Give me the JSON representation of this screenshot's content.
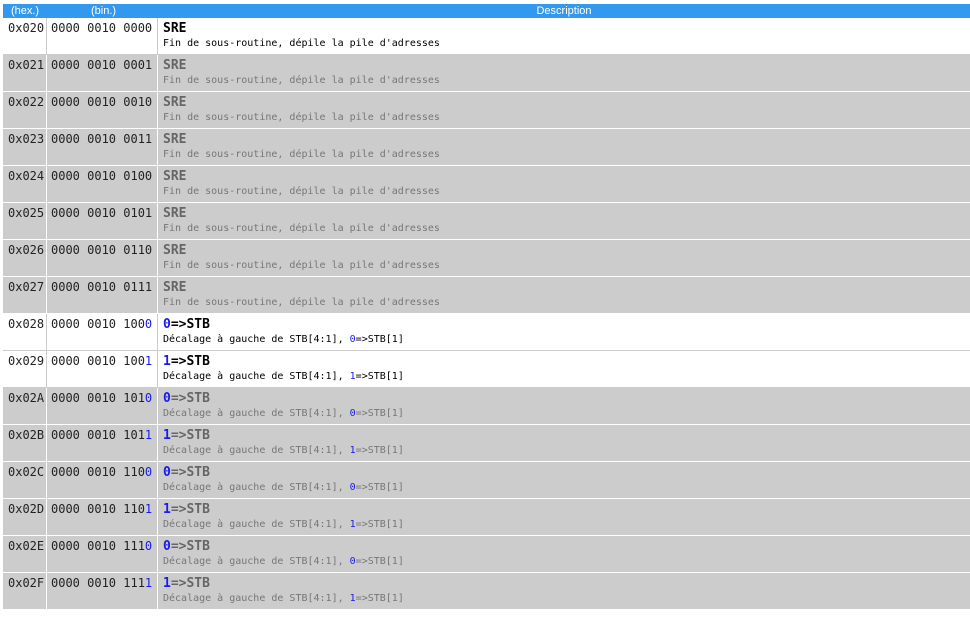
{
  "header": {
    "hex": "(hex.)",
    "bin": "(bin.)",
    "description": "Description"
  },
  "rows": [
    {
      "hex": "0x020",
      "bin_prefix": "0000 0010 0000",
      "bin_hi": "",
      "mn_hi": "",
      "mn_rest": "SRE",
      "desc_pre": "Fin de sous-routine, dépile la pile d'adresses",
      "desc_hi": "",
      "desc_post": "",
      "active": true
    },
    {
      "hex": "0x021",
      "bin_prefix": "0000 0010 0001",
      "bin_hi": "",
      "mn_hi": "",
      "mn_rest": "SRE",
      "desc_pre": "Fin de sous-routine, dépile la pile d'adresses",
      "desc_hi": "",
      "desc_post": "",
      "active": false
    },
    {
      "hex": "0x022",
      "bin_prefix": "0000 0010 0010",
      "bin_hi": "",
      "mn_hi": "",
      "mn_rest": "SRE",
      "desc_pre": "Fin de sous-routine, dépile la pile d'adresses",
      "desc_hi": "",
      "desc_post": "",
      "active": false
    },
    {
      "hex": "0x023",
      "bin_prefix": "0000 0010 0011",
      "bin_hi": "",
      "mn_hi": "",
      "mn_rest": "SRE",
      "desc_pre": "Fin de sous-routine, dépile la pile d'adresses",
      "desc_hi": "",
      "desc_post": "",
      "active": false
    },
    {
      "hex": "0x024",
      "bin_prefix": "0000 0010 0100",
      "bin_hi": "",
      "mn_hi": "",
      "mn_rest": "SRE",
      "desc_pre": "Fin de sous-routine, dépile la pile d'adresses",
      "desc_hi": "",
      "desc_post": "",
      "active": false
    },
    {
      "hex": "0x025",
      "bin_prefix": "0000 0010 0101",
      "bin_hi": "",
      "mn_hi": "",
      "mn_rest": "SRE",
      "desc_pre": "Fin de sous-routine, dépile la pile d'adresses",
      "desc_hi": "",
      "desc_post": "",
      "active": false
    },
    {
      "hex": "0x026",
      "bin_prefix": "0000 0010 0110",
      "bin_hi": "",
      "mn_hi": "",
      "mn_rest": "SRE",
      "desc_pre": "Fin de sous-routine, dépile la pile d'adresses",
      "desc_hi": "",
      "desc_post": "",
      "active": false
    },
    {
      "hex": "0x027",
      "bin_prefix": "0000 0010 0111",
      "bin_hi": "",
      "mn_hi": "",
      "mn_rest": "SRE",
      "desc_pre": "Fin de sous-routine, dépile la pile d'adresses",
      "desc_hi": "",
      "desc_post": "",
      "active": false
    },
    {
      "hex": "0x028",
      "bin_prefix": "0000 0010 100",
      "bin_hi": "0",
      "mn_hi": "0",
      "mn_rest": "=>STB",
      "desc_pre": "Décalage à gauche de STB[4:1], ",
      "desc_hi": "0",
      "desc_post": "=>STB[1]",
      "active": true
    },
    {
      "hex": "0x029",
      "bin_prefix": "0000 0010 100",
      "bin_hi": "1",
      "mn_hi": "1",
      "mn_rest": "=>STB",
      "desc_pre": "Décalage à gauche de STB[4:1], ",
      "desc_hi": "1",
      "desc_post": "=>STB[1]",
      "active": true
    },
    {
      "hex": "0x02A",
      "bin_prefix": "0000 0010 101",
      "bin_hi": "0",
      "mn_hi": "0",
      "mn_rest": "=>STB",
      "desc_pre": "Décalage à gauche de STB[4:1], ",
      "desc_hi": "0",
      "desc_post": "=>STB[1]",
      "active": false
    },
    {
      "hex": "0x02B",
      "bin_prefix": "0000 0010 101",
      "bin_hi": "1",
      "mn_hi": "1",
      "mn_rest": "=>STB",
      "desc_pre": "Décalage à gauche de STB[4:1], ",
      "desc_hi": "1",
      "desc_post": "=>STB[1]",
      "active": false
    },
    {
      "hex": "0x02C",
      "bin_prefix": "0000 0010 110",
      "bin_hi": "0",
      "mn_hi": "0",
      "mn_rest": "=>STB",
      "desc_pre": "Décalage à gauche de STB[4:1], ",
      "desc_hi": "0",
      "desc_post": "=>STB[1]",
      "active": false
    },
    {
      "hex": "0x02D",
      "bin_prefix": "0000 0010 110",
      "bin_hi": "1",
      "mn_hi": "1",
      "mn_rest": "=>STB",
      "desc_pre": "Décalage à gauche de STB[4:1], ",
      "desc_hi": "1",
      "desc_post": "=>STB[1]",
      "active": false
    },
    {
      "hex": "0x02E",
      "bin_prefix": "0000 0010 111",
      "bin_hi": "0",
      "mn_hi": "0",
      "mn_rest": "=>STB",
      "desc_pre": "Décalage à gauche de STB[4:1], ",
      "desc_hi": "0",
      "desc_post": "=>STB[1]",
      "active": false
    },
    {
      "hex": "0x02F",
      "bin_prefix": "0000 0010 111",
      "bin_hi": "1",
      "mn_hi": "1",
      "mn_rest": "=>STB",
      "desc_pre": "Décalage à gauche de STB[4:1], ",
      "desc_hi": "1",
      "desc_post": "=>STB[1]",
      "active": false
    }
  ],
  "colors": {
    "header_bg": "#3399ee",
    "active_row_bg": "#ffffff",
    "inactive_row_bg": "#cccccc",
    "highlight_bit": "#1a1aee"
  }
}
